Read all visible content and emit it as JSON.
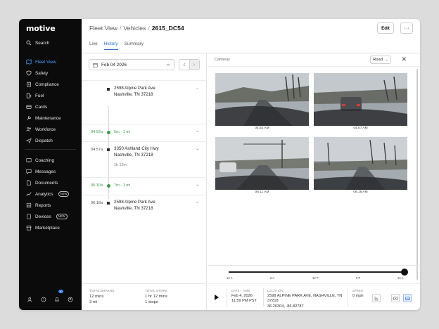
{
  "app": {
    "logo": "motive"
  },
  "sidebar": {
    "search": "Search",
    "items": [
      {
        "label": "Fleet View",
        "icon": "map-icon"
      },
      {
        "label": "Safety",
        "icon": "shield-icon"
      },
      {
        "label": "Compliance",
        "icon": "clipboard-icon"
      },
      {
        "label": "Fuel",
        "icon": "fuel-icon"
      },
      {
        "label": "Cards",
        "icon": "card-icon"
      },
      {
        "label": "Maintenance",
        "icon": "wrench-icon"
      },
      {
        "label": "Workforce",
        "icon": "people-icon"
      },
      {
        "label": "Dispatch",
        "icon": "send-icon"
      }
    ],
    "items2": [
      {
        "label": "Coaching",
        "icon": "coaching-icon"
      },
      {
        "label": "Messages",
        "icon": "chat-icon"
      },
      {
        "label": "Documents",
        "icon": "document-icon"
      },
      {
        "label": "Analytics",
        "icon": "analytics-icon",
        "badge": "NEW"
      },
      {
        "label": "Reports",
        "icon": "report-icon"
      },
      {
        "label": "Devices",
        "icon": "device-icon",
        "badge": "NEW"
      },
      {
        "label": "Marketplace",
        "icon": "store-icon"
      }
    ],
    "notification_count": "40"
  },
  "header": {
    "crumb1": "Fleet View",
    "crumb2": "Vehicles",
    "current": "2615_DC54",
    "edit_label": "Edit",
    "more_label": "···",
    "tabs": [
      "Live",
      "History",
      "Summary"
    ],
    "active_tab": "History"
  },
  "history": {
    "date": "Feb 04 2026",
    "stops": [
      {
        "address1": "2598 Alpine Park Ave",
        "address2": "Nashville, TN 37218"
      },
      {
        "time": "04:52a",
        "move": "5m · 1 mi"
      },
      {
        "time": "04:57a",
        "address1": "3350 Ashland City Hwy",
        "address2": "Nashville, TN 37218",
        "duration": "1h 12m"
      },
      {
        "time": "06:10a",
        "move": "7m · 1 mi"
      },
      {
        "time": "06:18a",
        "address1": "2598 Alpine Park Ave",
        "address2": "Nashville, TN 37218"
      }
    ],
    "totals": {
      "driving_label": "TOTAL DRIVING",
      "driving_time": "12 mins",
      "driving_dist": "3 mi",
      "stops_label": "TOTAL STOPS",
      "stops_time": "1 hr 12 mins",
      "stops_count": "1 stops"
    }
  },
  "cameras": {
    "title": "Cameras",
    "view": "Road",
    "thumbs": [
      "04:52 AM",
      "04:57 AM",
      "06:11 AM",
      "06:18 AM"
    ]
  },
  "scrubber": {
    "ticks": [
      "12 A",
      "6 A",
      "12 P",
      "6 P",
      "12 A"
    ],
    "position": 1.0
  },
  "details": {
    "datetime_label": "DATE / TIME",
    "date": "Feb 4, 2026",
    "time": "11:59 PM PST",
    "location_label": "LOCATION",
    "location1": "2598 ALPINE PARK AVE, NASHVILLE, TN",
    "location2": "37218",
    "coords": "36.20304, -86.82787",
    "speed_label": "SPEED",
    "speed": "0 mph"
  },
  "colors": {
    "accent": "#2b6fd6",
    "move": "#3a9a48",
    "sidebar": "#0b0b0c"
  }
}
